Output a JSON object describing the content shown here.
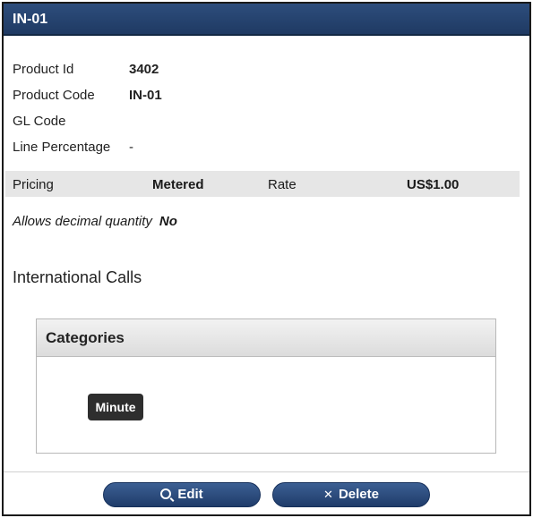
{
  "header": {
    "title": "IN-01"
  },
  "properties": [
    {
      "label": "Product Id",
      "value": "3402"
    },
    {
      "label": "Product Code",
      "value": "IN-01"
    },
    {
      "label": "GL Code",
      "value": ""
    },
    {
      "label": "Line Percentage",
      "value": "-"
    }
  ],
  "pricing": {
    "label": "Pricing",
    "value": "Metered",
    "rate_label": "Rate",
    "rate_value": "US$1.00"
  },
  "decimal_quantity": {
    "label": "Allows decimal quantity",
    "value": "No"
  },
  "product_name": "International Calls",
  "categories": {
    "title": "Categories",
    "tags": [
      "Minute"
    ]
  },
  "actions": {
    "edit_label": "Edit",
    "delete_label": "Delete",
    "edit_icon": "search-icon",
    "delete_icon": "close-icon"
  },
  "colors": {
    "header_bg": "#1f3a63",
    "button_bg": "#2a4a7c",
    "tag_bg": "#2e2e2e",
    "pricing_row_bg": "#e6e6e6"
  }
}
